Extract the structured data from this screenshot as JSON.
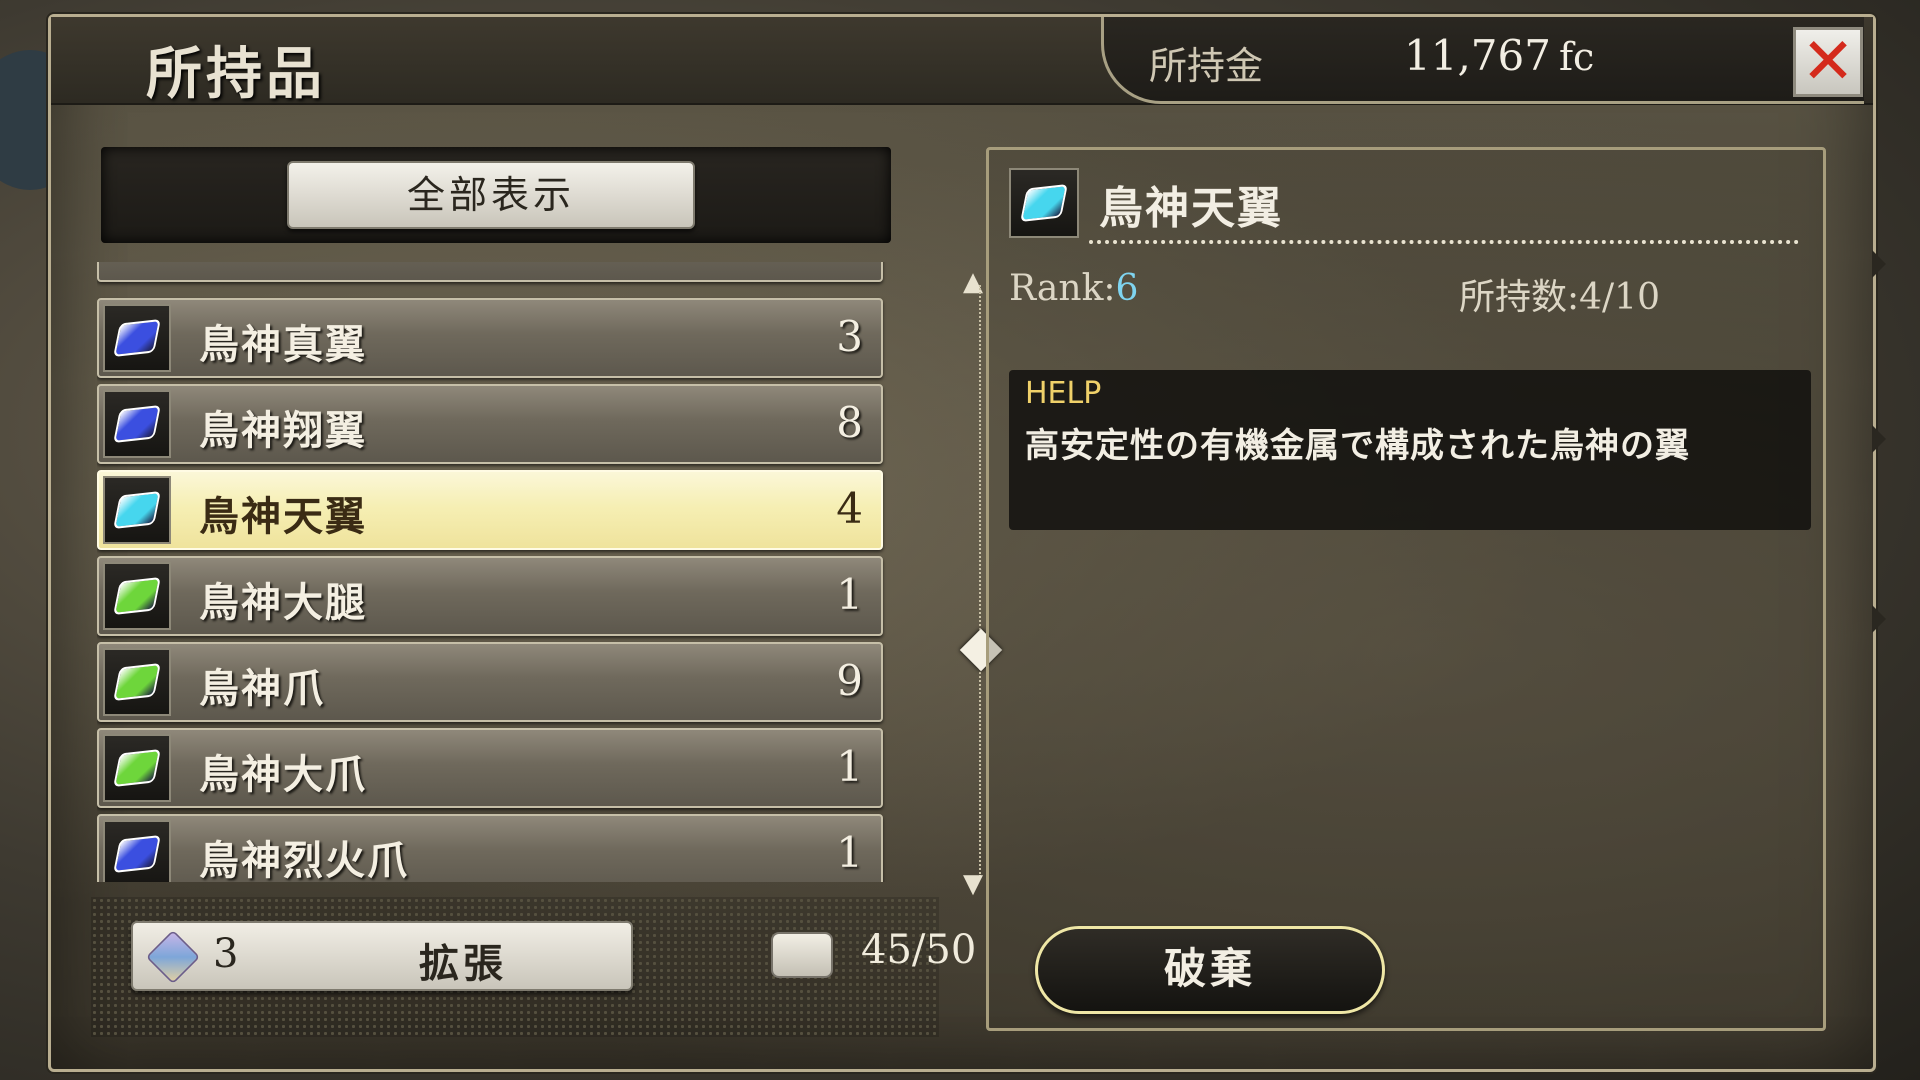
{
  "header": {
    "title": "所持品",
    "money_label": "所持金",
    "money_value": "11,767",
    "money_unit": "fc",
    "close_label": "✕"
  },
  "filter": {
    "button_label": "全部表示"
  },
  "items": [
    {
      "name": "鳥神真翼",
      "count": "3",
      "gem_color": "#3b4fe0",
      "selected": false
    },
    {
      "name": "鳥神翔翼",
      "count": "8",
      "gem_color": "#3b4fe0",
      "selected": false
    },
    {
      "name": "鳥神天翼",
      "count": "4",
      "gem_color": "#46d6ee",
      "selected": true
    },
    {
      "name": "鳥神大腿",
      "count": "1",
      "gem_color": "#6ed63b",
      "selected": false
    },
    {
      "name": "鳥神爪",
      "count": "9",
      "gem_color": "#6ed63b",
      "selected": false
    },
    {
      "name": "鳥神大爪",
      "count": "1",
      "gem_color": "#6ed63b",
      "selected": false
    },
    {
      "name": "鳥神烈火爪",
      "count": "1",
      "gem_color": "#3b4fe0",
      "selected": false
    }
  ],
  "scroll": {
    "up_icon": "▲",
    "down_icon": "▼"
  },
  "bottom": {
    "expand_count": "3",
    "expand_label": "拡張",
    "capacity": "45/50"
  },
  "detail": {
    "name": "鳥神天翼",
    "gem_color": "#46d6ee",
    "rank_label": "Rank:",
    "rank_value": "6",
    "owned_label": "所持数:4/10",
    "help_label": "HELP",
    "help_text": "高安定性の有機金属で構成された鳥神の翼",
    "discard_label": "破棄"
  }
}
